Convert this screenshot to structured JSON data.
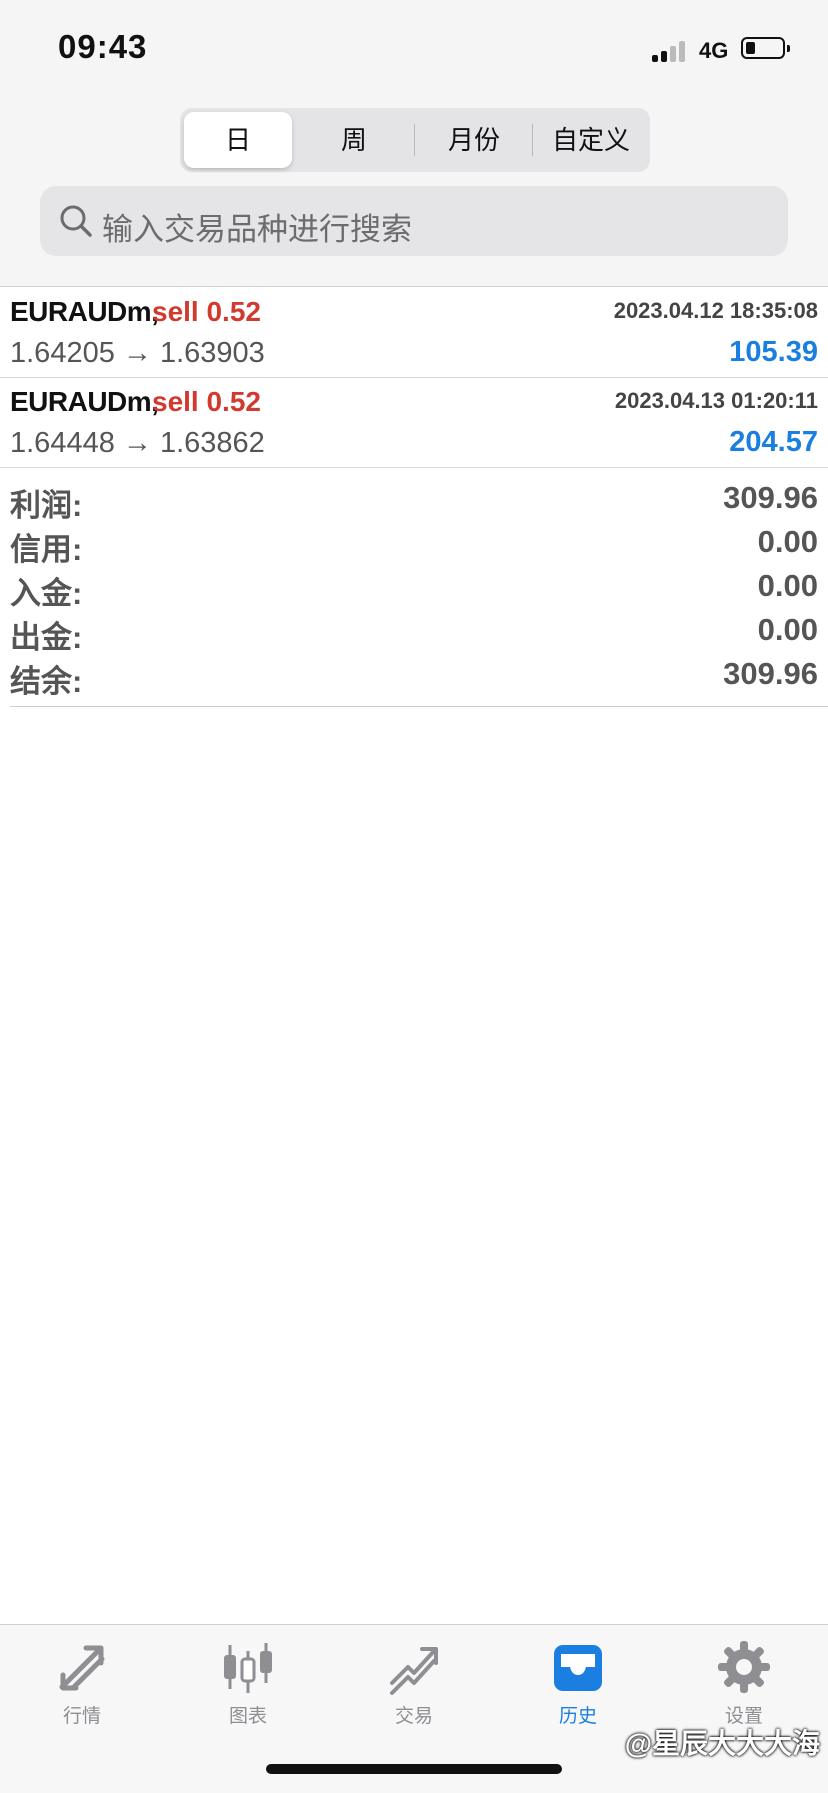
{
  "status": {
    "time": "09:43",
    "network": "4G"
  },
  "segments": [
    "日",
    "周",
    "月份",
    "自定义"
  ],
  "search": {
    "placeholder": "输入交易品种进行搜索"
  },
  "trades": [
    {
      "symbol": "EURAUDm,",
      "side": "sell 0.52",
      "datetime": "2023.04.12 18:35:08",
      "prices": "1.64205 → 1.63903",
      "profit": "105.39"
    },
    {
      "symbol": "EURAUDm,",
      "side": "sell 0.52",
      "datetime": "2023.04.13 01:20:11",
      "prices": "1.64448 → 1.63862",
      "profit": "204.57"
    }
  ],
  "summary": [
    {
      "label": "利润:",
      "value": "309.96"
    },
    {
      "label": "信用:",
      "value": "0.00"
    },
    {
      "label": "入金:",
      "value": "0.00"
    },
    {
      "label": "出金:",
      "value": "0.00"
    },
    {
      "label": "结余:",
      "value": "309.96"
    }
  ],
  "tabbar": [
    {
      "label": "行情",
      "icon": "quotes-arrows-icon"
    },
    {
      "label": "图表",
      "icon": "candlestick-chart-icon"
    },
    {
      "label": "交易",
      "icon": "trade-trend-icon"
    },
    {
      "label": "历史",
      "icon": "history-inbox-icon"
    },
    {
      "label": "设置",
      "icon": "gear-icon"
    }
  ],
  "active_tab": "历史",
  "watermark": "@星辰大大大海",
  "colors": {
    "sell": "#d23a2f",
    "profit": "#1a7fe0",
    "active_tab": "#1a7fe0"
  }
}
